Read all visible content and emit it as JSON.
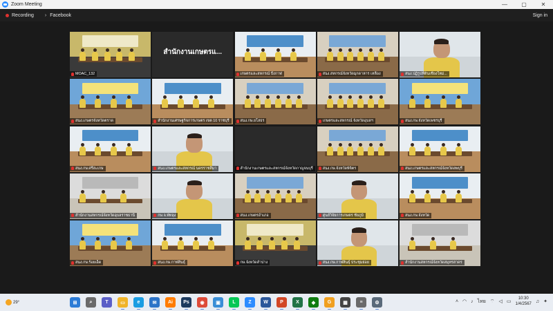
{
  "window": {
    "title": "Zoom Meeting",
    "controls": [
      "—",
      "▢",
      "✕"
    ]
  },
  "toolbar": {
    "recording_label": "Recording",
    "facebook_label": "Facebook",
    "signin_label": "Sign in"
  },
  "tiles": [
    {
      "label": "MOAC_132",
      "scene": "stage",
      "mic": false,
      "active": true
    },
    {
      "label": "",
      "big_name": "สำนักงานเกษตรแ...",
      "scene": "blank"
    },
    {
      "label": "เกษตรและสหกรณ์ บึงกาฬ",
      "scene": "office"
    },
    {
      "label": "สนง.สหกรณ์จังหวัดมุกดาหาร เหลือง",
      "scene": "room"
    },
    {
      "label": "สนง.ปฏิรูปที่ดินเชียงใหม่...",
      "scene": "face"
    },
    {
      "label": "สนง.เกษตรจังหวัดตราด",
      "scene": "blue"
    },
    {
      "label": "สำนักงานเศรษฐกิจการเกษตร เขต 10 ราชบุรี",
      "scene": "office"
    },
    {
      "label": "สนง.กษ.ยโสธร",
      "scene": "room"
    },
    {
      "label": "เกษตรและสหกรณ์ จังหวัดอุบลฯ",
      "scene": "room"
    },
    {
      "label": "สนง.กษ.จังหวัดเพชรบุรี",
      "scene": "blue"
    },
    {
      "label": "สนง.กษ.ศรีสะเกษ",
      "scene": "office"
    },
    {
      "label": "สนง.เกษตรและสหกรณ์ นครราชสีมา",
      "scene": "face"
    },
    {
      "label": "สำนักงานเกษตรและสหกรณ์จังหวัดกาญจนบุรี",
      "scene": "blank"
    },
    {
      "label": "สนง.กษ.จังหวัดพิจิตร",
      "scene": "room"
    },
    {
      "label": "สนง.เกษตรและสหกรณ์จังหวัดลพบุรี",
      "scene": "office"
    },
    {
      "label": "สำนักงานสหกรณ์จังหวัดอุบลราชธานี",
      "scene": "gray"
    },
    {
      "label": "กษ.จ.พัทลุง",
      "scene": "face"
    },
    {
      "label": "สนง.เกษตรอำเภอ",
      "scene": "room"
    },
    {
      "label": "ศูนย์วิจัยการเกษตร ชัยภูมิ",
      "scene": "face"
    },
    {
      "label": "สนง.กษ.จังหวัด",
      "scene": "office"
    },
    {
      "label": "สนง.กษ.ร้อยเอ็ด",
      "scene": "blue"
    },
    {
      "label": "สนง.กษ.กาฬสินธุ์",
      "scene": "office"
    },
    {
      "label": "กษ.จังหวัดลำปาง",
      "scene": "stage"
    },
    {
      "label": "สนง.กษ.กาฬสินธุ์ ประชุมย่อย",
      "scene": "face"
    },
    {
      "label": "สำนักงานสหกรณ์จังหวัดสมุทรสาคร",
      "scene": "gray"
    }
  ],
  "taskbar": {
    "weather": "29°",
    "apps": [
      {
        "name": "windows-start",
        "glyph": "⊞",
        "color": "#2b7bd6"
      },
      {
        "name": "search",
        "glyph": "⌕",
        "color": "#6a6a6a"
      },
      {
        "name": "teams",
        "glyph": "T",
        "color": "#5b5fc7"
      },
      {
        "name": "file-explorer",
        "glyph": "▭",
        "color": "#f0b429"
      },
      {
        "name": "edge",
        "glyph": "e",
        "color": "#1b9de2"
      },
      {
        "name": "mail",
        "glyph": "✉",
        "color": "#2d74c8"
      },
      {
        "name": "illustrator",
        "glyph": "Ai",
        "color": "#ff7c00"
      },
      {
        "name": "photoshop",
        "glyph": "Ps",
        "color": "#1c3a5e"
      },
      {
        "name": "chrome",
        "glyph": "◉",
        "color": "#dd4b39"
      },
      {
        "name": "photos",
        "glyph": "▣",
        "color": "#3a8ed6"
      },
      {
        "name": "line",
        "glyph": "L",
        "color": "#06c755"
      },
      {
        "name": "zoom",
        "glyph": "Z",
        "color": "#2d8cff"
      },
      {
        "name": "word",
        "glyph": "W",
        "color": "#2b579a"
      },
      {
        "name": "powerpoint",
        "glyph": "P",
        "color": "#d24726"
      },
      {
        "name": "excel",
        "glyph": "X",
        "color": "#217346"
      },
      {
        "name": "xbox-game",
        "glyph": "◆",
        "color": "#107c10"
      },
      {
        "name": "gallery",
        "glyph": "G",
        "color": "#f0a020"
      },
      {
        "name": "calculator",
        "glyph": "▦",
        "color": "#444"
      },
      {
        "name": "notes",
        "glyph": "≡",
        "color": "#6a6a6a"
      },
      {
        "name": "settings",
        "glyph": "⚙",
        "color": "#5a6a7a"
      }
    ],
    "lang": "ไทย",
    "time": "10:30",
    "date": "1/4/2567"
  }
}
